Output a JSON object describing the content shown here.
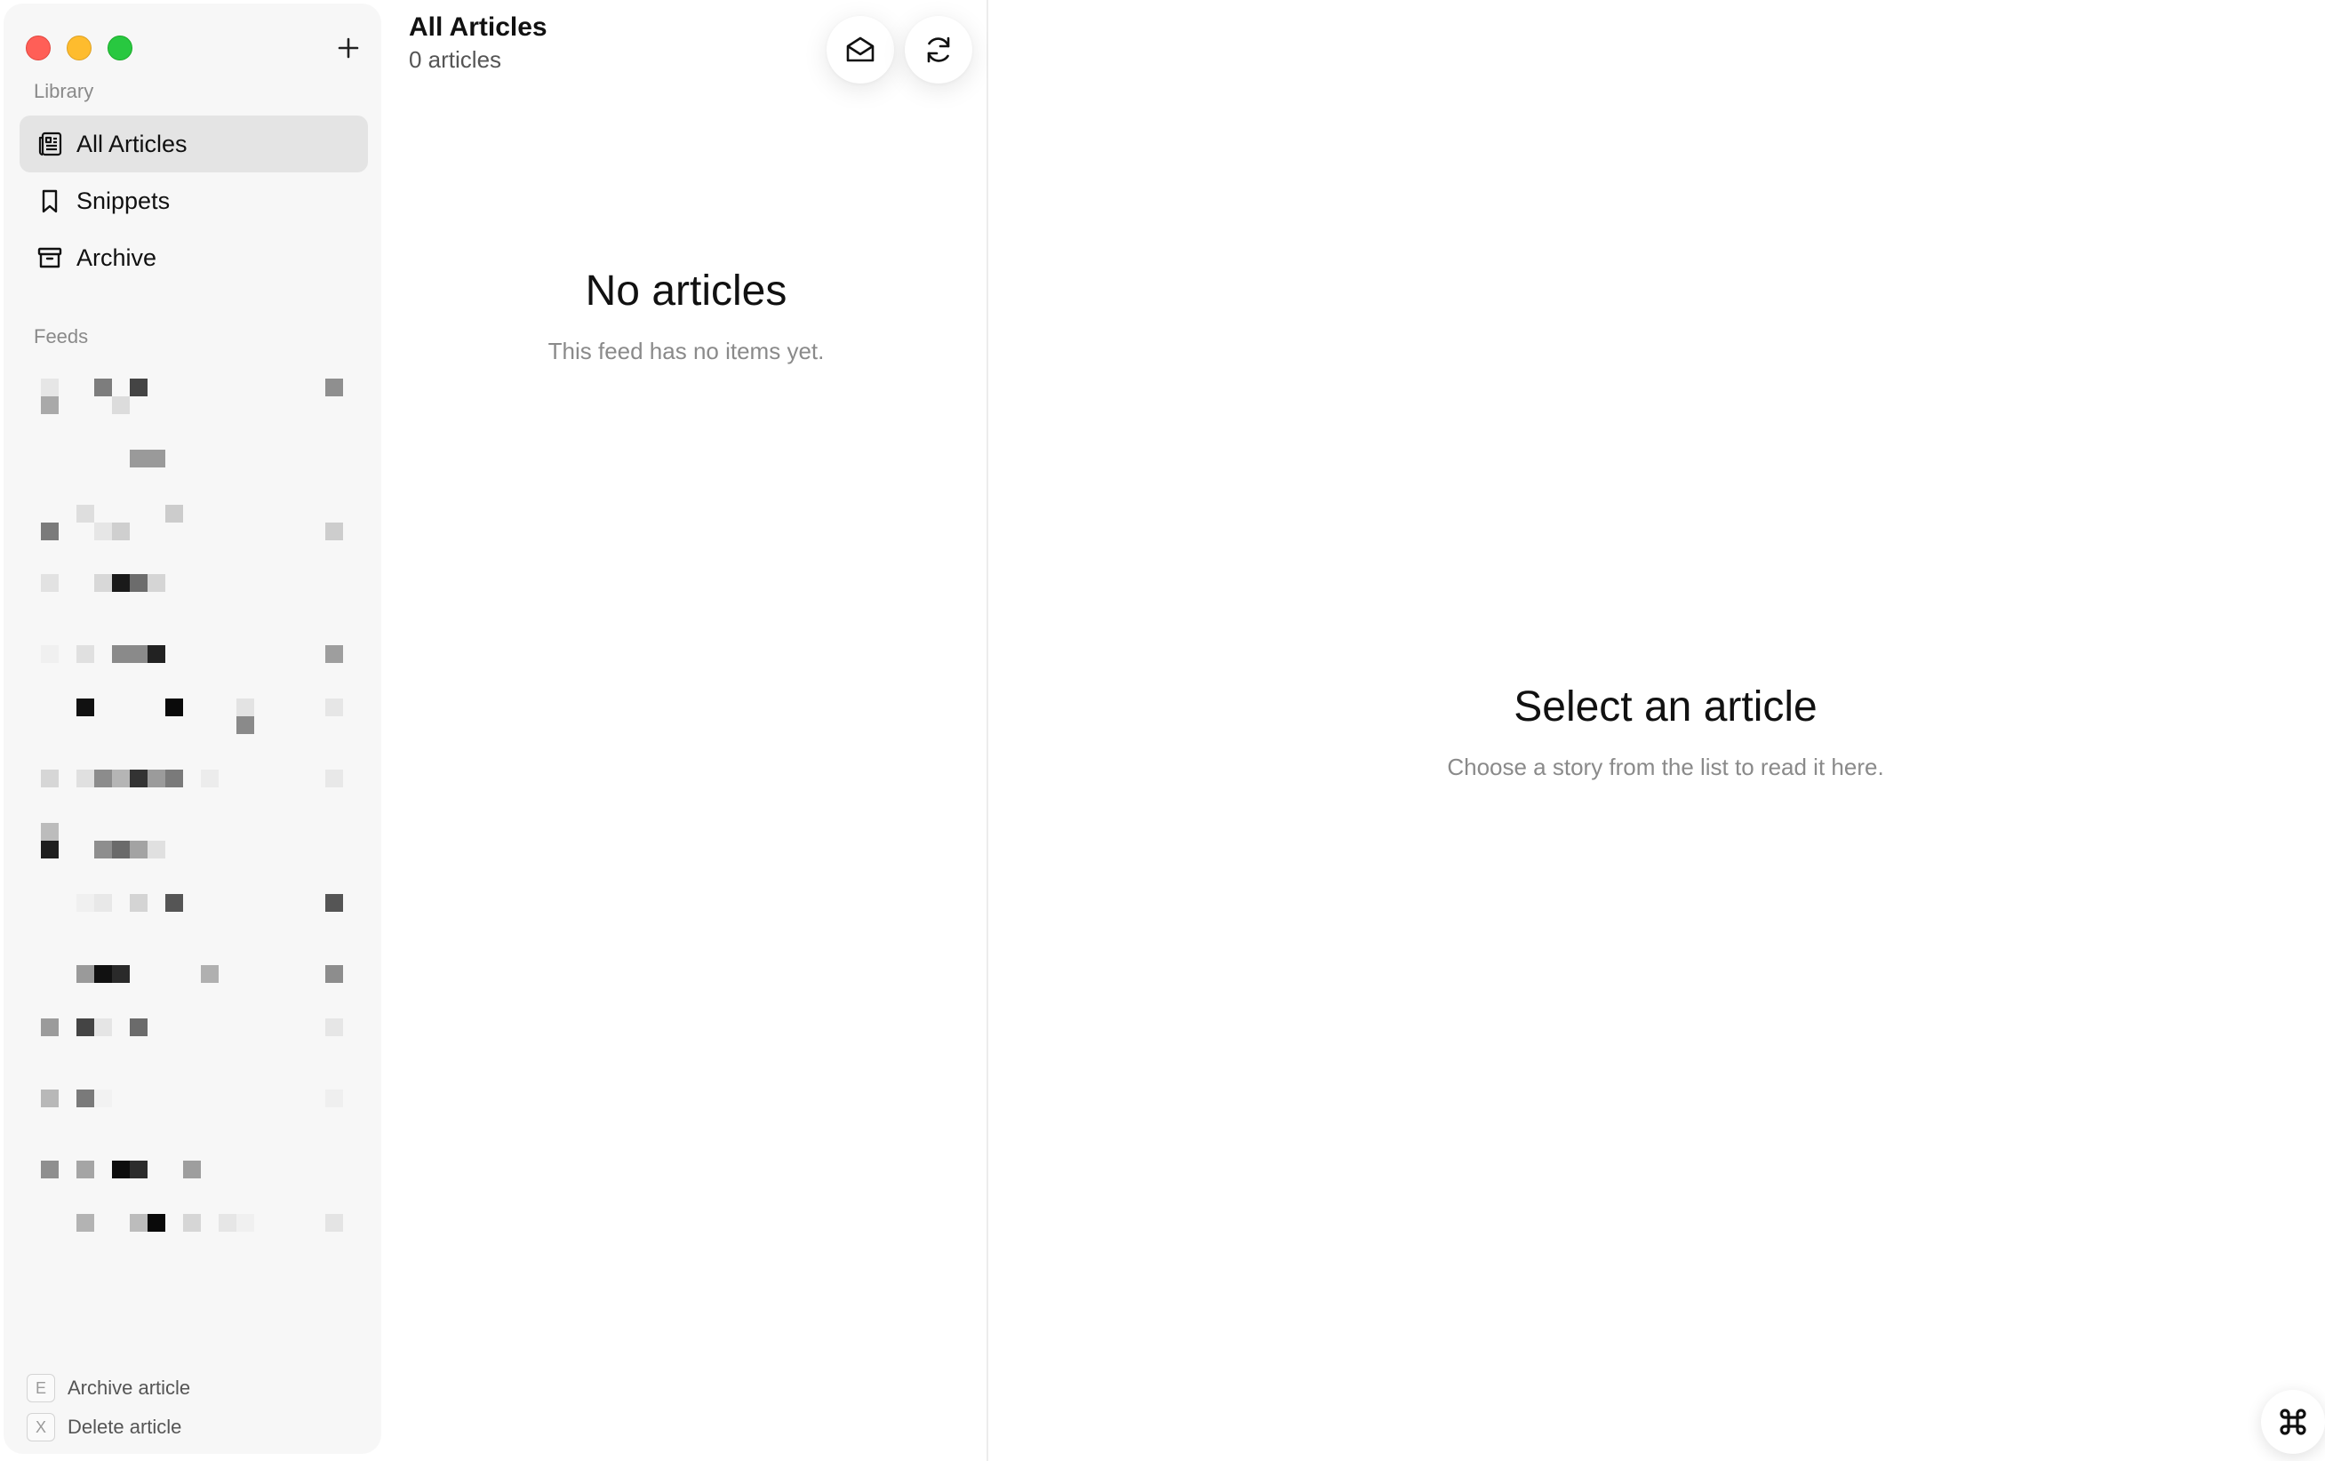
{
  "window": {
    "traffic_lights": [
      "close",
      "minimize",
      "maximize"
    ]
  },
  "sidebar": {
    "add_icon": "plus-icon",
    "library_label": "Library",
    "items": [
      {
        "label": "All Articles",
        "icon": "newspaper-icon",
        "active": true
      },
      {
        "label": "Snippets",
        "icon": "bookmark-icon",
        "active": false
      },
      {
        "label": "Archive",
        "icon": "archive-box-icon",
        "active": false
      }
    ],
    "feeds_label": "Feeds",
    "shortcuts": [
      {
        "key": "E",
        "label": "Archive article"
      },
      {
        "key": "X",
        "label": "Delete article"
      }
    ]
  },
  "list": {
    "title": "All Articles",
    "count": "0 articles",
    "mark_read_icon": "envelope-open-icon",
    "refresh_icon": "refresh-icon",
    "empty_title": "No articles",
    "empty_subtitle": "This feed has no items yet."
  },
  "reader": {
    "empty_title": "Select an article",
    "empty_subtitle": "Choose a story from the list to read it here.",
    "corner_icon": "command-icon"
  },
  "colors": {
    "sidebar_bg": "#f7f7f7",
    "active_item_bg": "#e4e4e4",
    "muted_text": "#8a8a8a",
    "close": "#ff5f57",
    "minimize": "#febc2e",
    "maximize": "#28c840"
  }
}
